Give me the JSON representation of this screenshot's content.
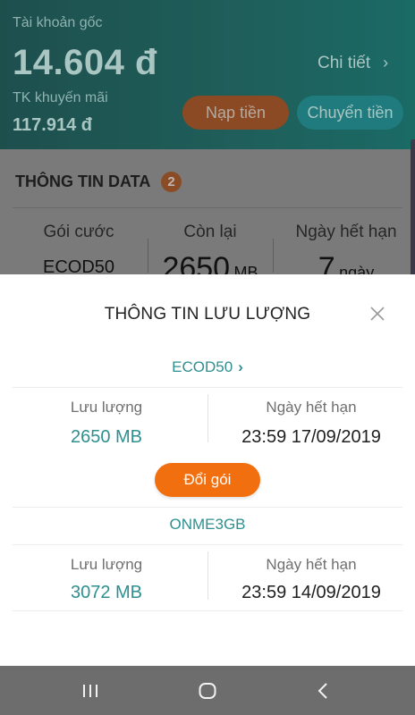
{
  "header": {
    "main_account_label": "Tài khoản gốc",
    "main_balance": "14.604 đ",
    "detail_link": "Chi tiết",
    "promo_account_label": "TK khuyến mãi",
    "promo_balance": "117.914 đ",
    "topup_button": "Nạp tiền",
    "transfer_button": "Chuyển tiền"
  },
  "data_info": {
    "title": "THÔNG TIN DATA",
    "badge_count": "2",
    "columns": {
      "plan_label": "Gói cước",
      "plan_value": "ECOD50",
      "remaining_label": "Còn lại",
      "remaining_value": "2650",
      "remaining_unit": "MB",
      "expiry_label": "Ngày hết hạn",
      "expiry_value": "7",
      "expiry_unit": "ngày"
    }
  },
  "sheet": {
    "title": "THÔNG TIN LƯU LƯỢNG",
    "packages": [
      {
        "name": "ECOD50",
        "traffic_label": "Lưu lượng",
        "traffic_value": "2650 MB",
        "expiry_label": "Ngày hết hạn",
        "expiry_value": "23:59 17/09/2019"
      },
      {
        "name": "ONME3GB",
        "traffic_label": "Lưu lượng",
        "traffic_value": "3072 MB",
        "expiry_label": "Ngày hết hạn",
        "expiry_value": "23:59 14/09/2019"
      }
    ],
    "change_button": "Đổi gói"
  },
  "colors": {
    "accent_teal": "#2f8f8f",
    "accent_orange": "#f26f0f"
  },
  "icons": {
    "close": "close-icon",
    "chevron": "chevron-right-icon",
    "nav_recents": "recents-icon",
    "nav_home": "home-icon",
    "nav_back": "back-icon"
  }
}
